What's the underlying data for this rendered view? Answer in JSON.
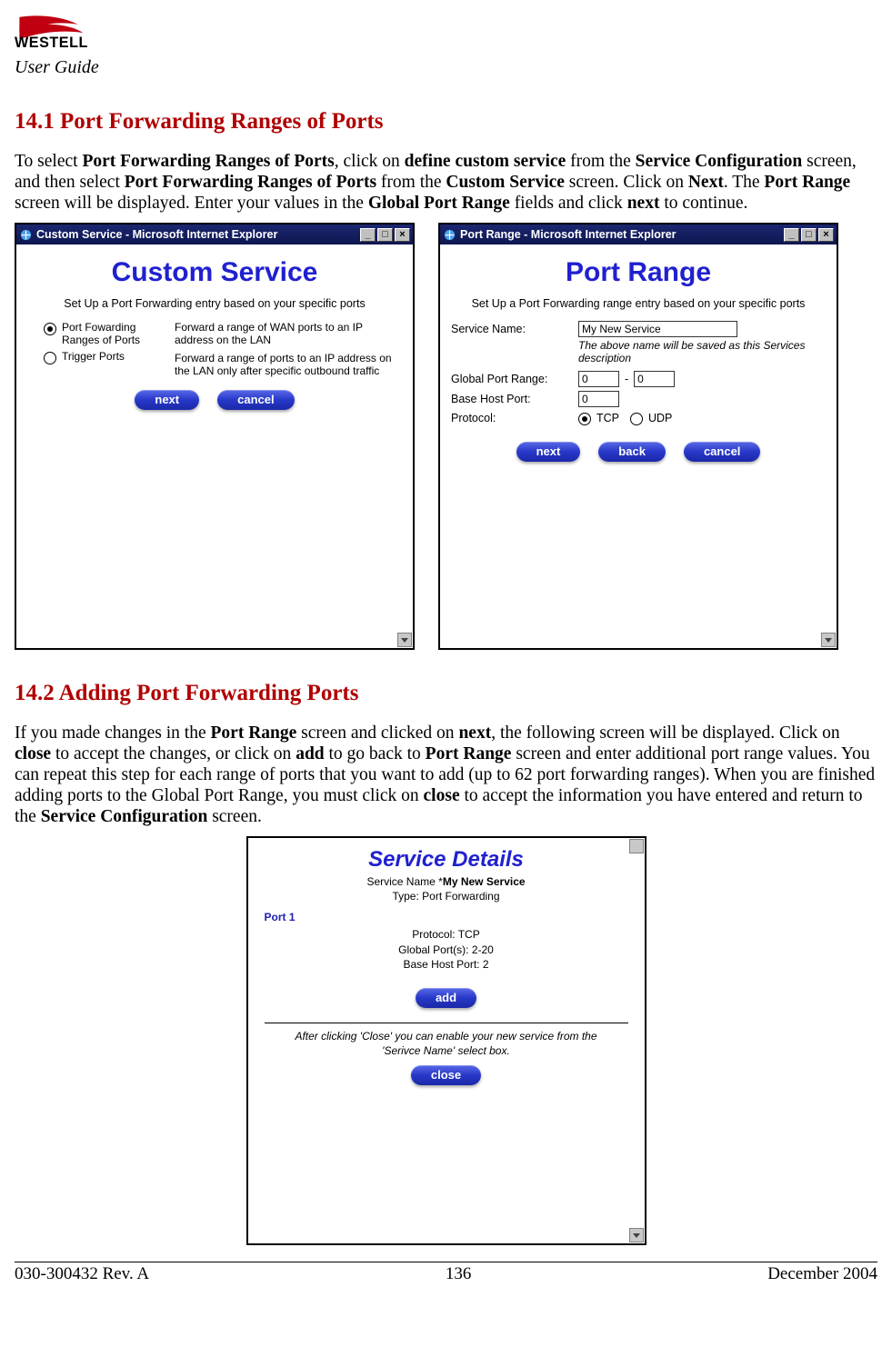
{
  "header": {
    "brand": "WESTELL",
    "subtitle": "User Guide"
  },
  "section1": {
    "number": "14.1",
    "title": "Port Forwarding Ranges of Ports",
    "para_parts": [
      "To select ",
      "Port Forwarding Ranges of Ports",
      ", click on ",
      "define custom service",
      " from the ",
      "Service Configuration",
      " screen, and then select ",
      "Port Forwarding Ranges of Ports",
      " from the ",
      "Custom Service",
      " screen. Click on ",
      "Next",
      ". The ",
      "Port Range",
      " screen will be displayed. Enter your values in the ",
      "Global Port Range",
      " fields and click ",
      "next",
      " to continue."
    ]
  },
  "shot_custom": {
    "window_title": "Custom Service - Microsoft Internet Explorer",
    "title": "Custom Service",
    "subtitle": "Set Up a Port Forwarding entry based on your specific ports",
    "opt1_label": "Port Fowarding Ranges of Ports",
    "opt1_desc": "Forward a range of WAN ports to an IP address on the LAN",
    "opt2_label": "Trigger Ports",
    "opt2_desc": "Forward a range of ports to an IP address on the LAN only after specific outbound traffic",
    "btn_next": "next",
    "btn_cancel": "cancel"
  },
  "shot_range": {
    "window_title": "Port Range - Microsoft Internet Explorer",
    "title": "Port Range",
    "subtitle": "Set Up a Port Forwarding range entry based on your specific ports",
    "lbl_service": "Service Name:",
    "val_service": "My New Service",
    "hint": "The above name will be saved as this Services description",
    "lbl_global": "Global Port Range:",
    "val_global_a": "0",
    "dash": "-",
    "val_global_b": "0",
    "lbl_base": "Base Host Port:",
    "val_base": "0",
    "lbl_proto": "Protocol:",
    "proto_tcp": "TCP",
    "proto_udp": "UDP",
    "btn_next": "next",
    "btn_back": "back",
    "btn_cancel": "cancel"
  },
  "section2": {
    "number": "14.2",
    "title": "Adding Port Forwarding Ports",
    "para_parts": [
      "If you made changes in the ",
      "Port Range",
      " screen and clicked on ",
      "next",
      ", the following screen will be displayed. Click on ",
      "close",
      " to accept the changes, or click on ",
      "add",
      " to go back to ",
      "Port Range",
      " screen and enter additional port range values. You can repeat this step for each range of ports that you want to add (up to 62 port forwarding ranges). When you are finished adding ports to the Global Port Range, you must click on ",
      "close",
      " to accept the information you have entered and return to the ",
      "Service Configuration",
      " screen."
    ]
  },
  "shot_details": {
    "title": "Service Details",
    "svc_line_label": "Service Name *",
    "svc_line_value": "My New Service",
    "type_line": "Type: Port Forwarding",
    "port_header": "Port 1",
    "proto_line": "Protocol: TCP",
    "global_line": "Global Port(s): 2-20",
    "base_line": "Base Host Port: 2",
    "btn_add": "add",
    "close_hint": "After clicking 'Close' you can enable your new service from the 'Serivce Name' select box.",
    "btn_close": "close"
  },
  "footer": {
    "left": "030-300432 Rev. A",
    "center": "136",
    "right": "December 2004"
  }
}
